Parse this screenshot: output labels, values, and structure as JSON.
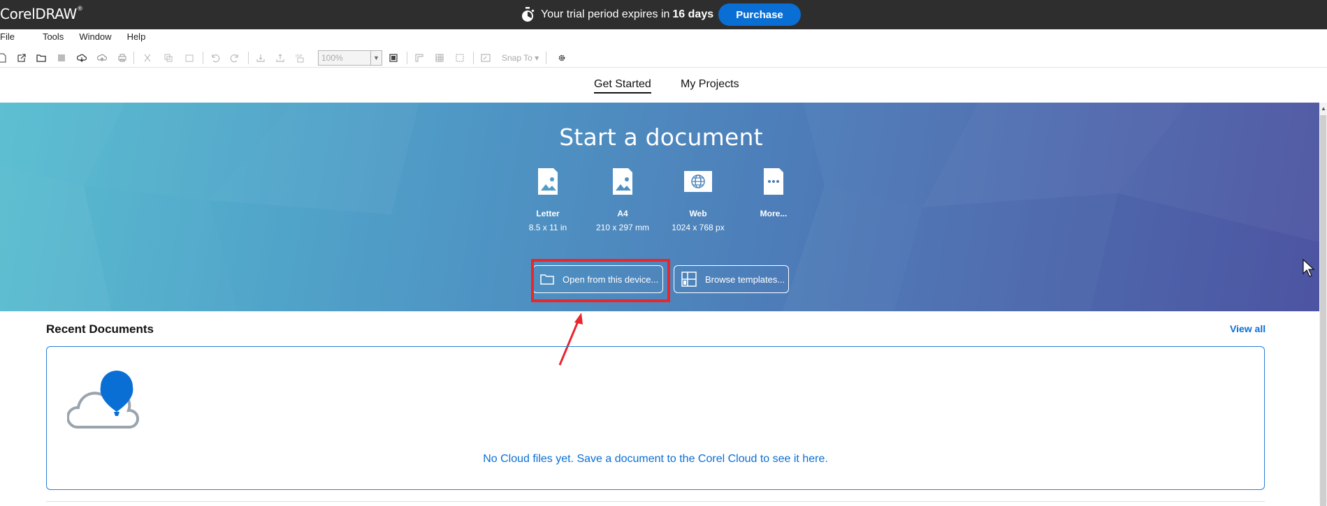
{
  "app": {
    "title": "CorelDRAW",
    "trademark": "®"
  },
  "trial": {
    "prefix": "Your trial period expires in",
    "days": "16 days",
    "purchase_label": "Purchase"
  },
  "menu": [
    "File",
    "Tools",
    "Window",
    "Help"
  ],
  "toolbar": {
    "zoom_value": "100%",
    "snap_label": "Snap To"
  },
  "tabs": [
    {
      "label": "Get Started",
      "active": true
    },
    {
      "label": "My Projects",
      "active": false
    }
  ],
  "hero": {
    "title": "Start a document",
    "options": [
      {
        "name": "Letter",
        "size": "8.5 x 11 in",
        "icon": "document-image-icon"
      },
      {
        "name": "A4",
        "size": "210 x 297 mm",
        "icon": "document-image-icon"
      },
      {
        "name": "Web",
        "size": "1024 x 768 px",
        "icon": "web-globe-icon"
      },
      {
        "name": "More...",
        "size": "",
        "icon": "more-document-icon"
      }
    ],
    "open_label": "Open from this device...",
    "browse_label": "Browse templates..."
  },
  "recent": {
    "title": "Recent Documents",
    "view_all": "View all",
    "empty_message": "No Cloud files yet. Save a document to the Corel Cloud to see it here."
  },
  "colors": {
    "accent": "#0a6fd4",
    "highlight": "#e8262c",
    "titlebar": "#2e2e2e"
  }
}
